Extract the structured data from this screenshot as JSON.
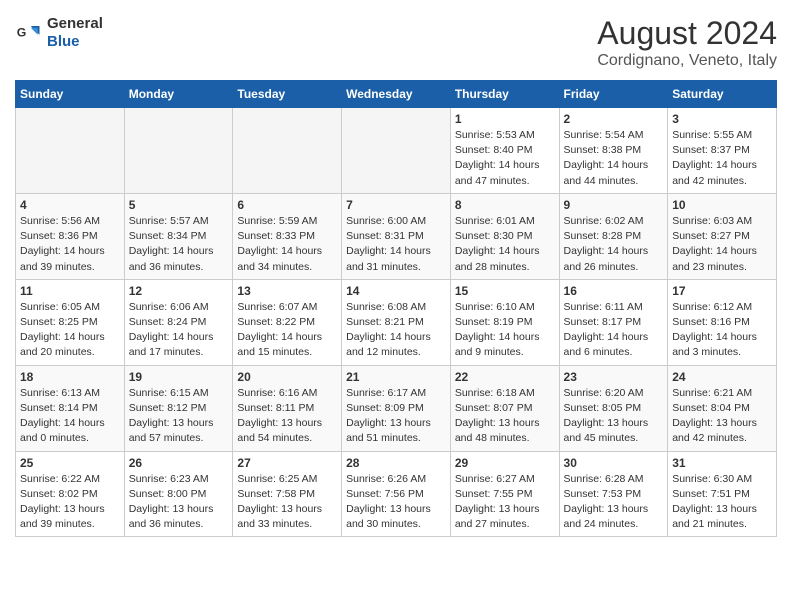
{
  "header": {
    "logo_general": "General",
    "logo_blue": "Blue",
    "title": "August 2024",
    "subtitle": "Cordignano, Veneto, Italy"
  },
  "weekdays": [
    "Sunday",
    "Monday",
    "Tuesday",
    "Wednesday",
    "Thursday",
    "Friday",
    "Saturday"
  ],
  "weeks": [
    [
      {
        "day": "",
        "empty": true
      },
      {
        "day": "",
        "empty": true
      },
      {
        "day": "",
        "empty": true
      },
      {
        "day": "",
        "empty": true
      },
      {
        "day": "1",
        "info": "Sunrise: 5:53 AM\nSunset: 8:40 PM\nDaylight: 14 hours\nand 47 minutes."
      },
      {
        "day": "2",
        "info": "Sunrise: 5:54 AM\nSunset: 8:38 PM\nDaylight: 14 hours\nand 44 minutes."
      },
      {
        "day": "3",
        "info": "Sunrise: 5:55 AM\nSunset: 8:37 PM\nDaylight: 14 hours\nand 42 minutes."
      }
    ],
    [
      {
        "day": "4",
        "info": "Sunrise: 5:56 AM\nSunset: 8:36 PM\nDaylight: 14 hours\nand 39 minutes."
      },
      {
        "day": "5",
        "info": "Sunrise: 5:57 AM\nSunset: 8:34 PM\nDaylight: 14 hours\nand 36 minutes."
      },
      {
        "day": "6",
        "info": "Sunrise: 5:59 AM\nSunset: 8:33 PM\nDaylight: 14 hours\nand 34 minutes."
      },
      {
        "day": "7",
        "info": "Sunrise: 6:00 AM\nSunset: 8:31 PM\nDaylight: 14 hours\nand 31 minutes."
      },
      {
        "day": "8",
        "info": "Sunrise: 6:01 AM\nSunset: 8:30 PM\nDaylight: 14 hours\nand 28 minutes."
      },
      {
        "day": "9",
        "info": "Sunrise: 6:02 AM\nSunset: 8:28 PM\nDaylight: 14 hours\nand 26 minutes."
      },
      {
        "day": "10",
        "info": "Sunrise: 6:03 AM\nSunset: 8:27 PM\nDaylight: 14 hours\nand 23 minutes."
      }
    ],
    [
      {
        "day": "11",
        "info": "Sunrise: 6:05 AM\nSunset: 8:25 PM\nDaylight: 14 hours\nand 20 minutes."
      },
      {
        "day": "12",
        "info": "Sunrise: 6:06 AM\nSunset: 8:24 PM\nDaylight: 14 hours\nand 17 minutes."
      },
      {
        "day": "13",
        "info": "Sunrise: 6:07 AM\nSunset: 8:22 PM\nDaylight: 14 hours\nand 15 minutes."
      },
      {
        "day": "14",
        "info": "Sunrise: 6:08 AM\nSunset: 8:21 PM\nDaylight: 14 hours\nand 12 minutes."
      },
      {
        "day": "15",
        "info": "Sunrise: 6:10 AM\nSunset: 8:19 PM\nDaylight: 14 hours\nand 9 minutes."
      },
      {
        "day": "16",
        "info": "Sunrise: 6:11 AM\nSunset: 8:17 PM\nDaylight: 14 hours\nand 6 minutes."
      },
      {
        "day": "17",
        "info": "Sunrise: 6:12 AM\nSunset: 8:16 PM\nDaylight: 14 hours\nand 3 minutes."
      }
    ],
    [
      {
        "day": "18",
        "info": "Sunrise: 6:13 AM\nSunset: 8:14 PM\nDaylight: 14 hours\nand 0 minutes."
      },
      {
        "day": "19",
        "info": "Sunrise: 6:15 AM\nSunset: 8:12 PM\nDaylight: 13 hours\nand 57 minutes."
      },
      {
        "day": "20",
        "info": "Sunrise: 6:16 AM\nSunset: 8:11 PM\nDaylight: 13 hours\nand 54 minutes."
      },
      {
        "day": "21",
        "info": "Sunrise: 6:17 AM\nSunset: 8:09 PM\nDaylight: 13 hours\nand 51 minutes."
      },
      {
        "day": "22",
        "info": "Sunrise: 6:18 AM\nSunset: 8:07 PM\nDaylight: 13 hours\nand 48 minutes."
      },
      {
        "day": "23",
        "info": "Sunrise: 6:20 AM\nSunset: 8:05 PM\nDaylight: 13 hours\nand 45 minutes."
      },
      {
        "day": "24",
        "info": "Sunrise: 6:21 AM\nSunset: 8:04 PM\nDaylight: 13 hours\nand 42 minutes."
      }
    ],
    [
      {
        "day": "25",
        "info": "Sunrise: 6:22 AM\nSunset: 8:02 PM\nDaylight: 13 hours\nand 39 minutes."
      },
      {
        "day": "26",
        "info": "Sunrise: 6:23 AM\nSunset: 8:00 PM\nDaylight: 13 hours\nand 36 minutes."
      },
      {
        "day": "27",
        "info": "Sunrise: 6:25 AM\nSunset: 7:58 PM\nDaylight: 13 hours\nand 33 minutes."
      },
      {
        "day": "28",
        "info": "Sunrise: 6:26 AM\nSunset: 7:56 PM\nDaylight: 13 hours\nand 30 minutes."
      },
      {
        "day": "29",
        "info": "Sunrise: 6:27 AM\nSunset: 7:55 PM\nDaylight: 13 hours\nand 27 minutes."
      },
      {
        "day": "30",
        "info": "Sunrise: 6:28 AM\nSunset: 7:53 PM\nDaylight: 13 hours\nand 24 minutes."
      },
      {
        "day": "31",
        "info": "Sunrise: 6:30 AM\nSunset: 7:51 PM\nDaylight: 13 hours\nand 21 minutes."
      }
    ]
  ]
}
